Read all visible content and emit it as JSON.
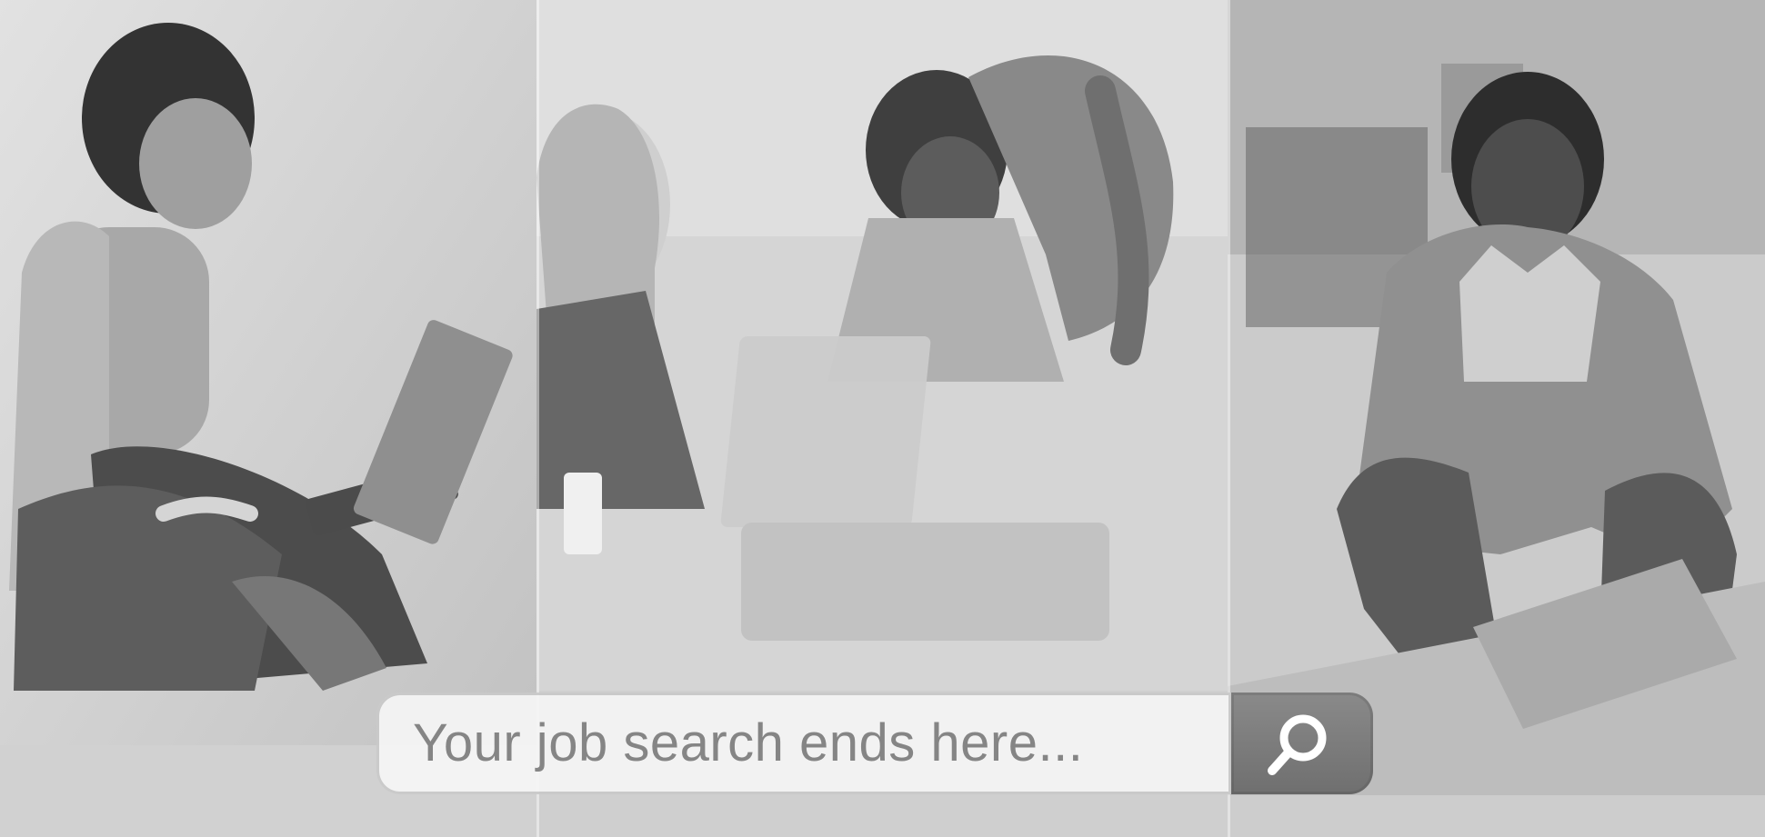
{
  "search": {
    "text": "Your job search ends here..."
  },
  "icons": {
    "search_icon": "magnifying-glass"
  },
  "colors": {
    "page_background": "#d9d9d9",
    "search_bar_fill": "#f4f4f4",
    "search_text": "#858585",
    "search_button": "#7a7a7a",
    "search_icon": "#ffffff"
  }
}
